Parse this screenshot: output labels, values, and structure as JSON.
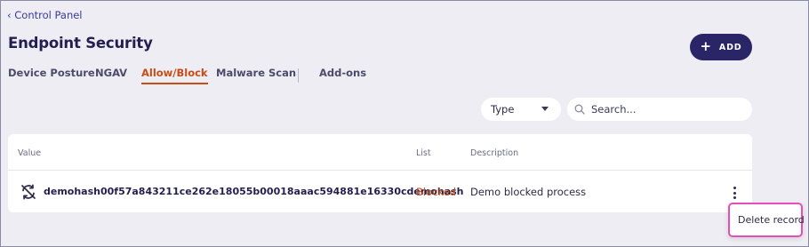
{
  "header": {
    "back_link": "‹ Control Panel",
    "title": "Endpoint Security",
    "add_label": "ADD",
    "add_icon": "plus-icon"
  },
  "tabs": [
    {
      "label": "Device Posture"
    },
    {
      "label": "NGAV"
    },
    {
      "label": "Allow/Block",
      "active": true
    },
    {
      "label": "Malware Scan"
    },
    {
      "label": "Add-ons"
    }
  ],
  "filters": {
    "type_label": "Type",
    "search_placeholder": "Search...",
    "search_value": ""
  },
  "table": {
    "columns": [
      "Value",
      "List",
      "Description"
    ],
    "rows": [
      {
        "icon": "block-sync-icon",
        "value": "demohash00f57a843211ce262e18055b00018aaac594881e16330cdemohash",
        "list": "Blocked",
        "description": "Demo blocked process"
      }
    ]
  },
  "row_menu": {
    "items": [
      "Delete record"
    ]
  },
  "colors": {
    "accent_orange": "#c84d14",
    "primary_navy": "#2a2566",
    "highlight_pink": "#e34fb6",
    "background": "#eeedf3"
  }
}
